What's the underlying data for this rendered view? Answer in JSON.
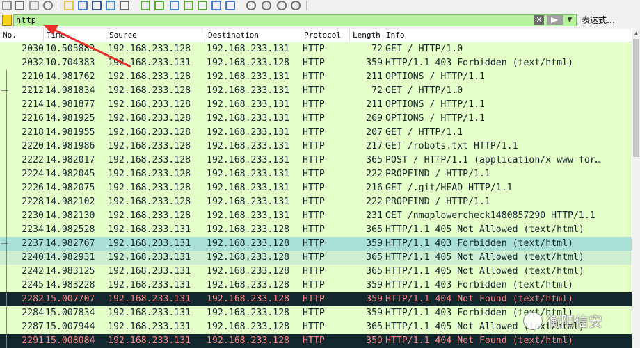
{
  "toolbar": {
    "icons": [
      "shark-fin-start-icon",
      "stop-icon",
      "restart-icon",
      "options-icon",
      "open-file-icon",
      "save-icon",
      "close-file-icon",
      "reload-icon",
      "find-icon",
      "back-icon",
      "forward-icon",
      "goto-icon",
      "first-icon",
      "last-icon",
      "autoscroll-icon",
      "colorize-icon",
      "zoom-in-icon",
      "zoom-out-icon",
      "zoom-normal-icon",
      "resize-columns-icon"
    ]
  },
  "filter": {
    "value": "http",
    "expression_label": "表达式…",
    "background": "#b8f29f"
  },
  "columns": [
    "No.",
    "Time",
    "Source",
    "Destination",
    "Protocol",
    "Length",
    "Info"
  ],
  "rows": [
    {
      "no": "2030",
      "time": "10.505883",
      "src": "192.168.233.128",
      "dst": "192.168.233.131",
      "proto": "HTTP",
      "len": "72",
      "info": "GET / HTTP/1.0",
      "style": "normal"
    },
    {
      "no": "2032",
      "time": "10.704383",
      "src": "192.168.233.131",
      "dst": "192.168.233.128",
      "proto": "HTTP",
      "len": "359",
      "info": "HTTP/1.1 403 Forbidden  (text/html)",
      "style": "normal"
    },
    {
      "no": "2210",
      "time": "14.981762",
      "src": "192.168.233.128",
      "dst": "192.168.233.131",
      "proto": "HTTP",
      "len": "211",
      "info": "OPTIONS / HTTP/1.1",
      "style": "normal"
    },
    {
      "no": "2212",
      "time": "14.981834",
      "src": "192.168.233.128",
      "dst": "192.168.233.131",
      "proto": "HTTP",
      "len": "72",
      "info": "GET / HTTP/1.0",
      "style": "normal"
    },
    {
      "no": "2214",
      "time": "14.981877",
      "src": "192.168.233.128",
      "dst": "192.168.233.131",
      "proto": "HTTP",
      "len": "211",
      "info": "OPTIONS / HTTP/1.1",
      "style": "normal"
    },
    {
      "no": "2216",
      "time": "14.981925",
      "src": "192.168.233.128",
      "dst": "192.168.233.131",
      "proto": "HTTP",
      "len": "269",
      "info": "OPTIONS / HTTP/1.1",
      "style": "normal"
    },
    {
      "no": "2218",
      "time": "14.981955",
      "src": "192.168.233.128",
      "dst": "192.168.233.131",
      "proto": "HTTP",
      "len": "207",
      "info": "GET / HTTP/1.1",
      "style": "normal"
    },
    {
      "no": "2220",
      "time": "14.981986",
      "src": "192.168.233.128",
      "dst": "192.168.233.131",
      "proto": "HTTP",
      "len": "217",
      "info": "GET /robots.txt HTTP/1.1",
      "style": "normal"
    },
    {
      "no": "2222",
      "time": "14.982017",
      "src": "192.168.233.128",
      "dst": "192.168.233.131",
      "proto": "HTTP",
      "len": "365",
      "info": "POST / HTTP/1.1  (application/x-www-for…",
      "style": "normal"
    },
    {
      "no": "2224",
      "time": "14.982045",
      "src": "192.168.233.128",
      "dst": "192.168.233.131",
      "proto": "HTTP",
      "len": "222",
      "info": "PROPFIND / HTTP/1.1",
      "style": "normal"
    },
    {
      "no": "2226",
      "time": "14.982075",
      "src": "192.168.233.128",
      "dst": "192.168.233.131",
      "proto": "HTTP",
      "len": "216",
      "info": "GET /.git/HEAD HTTP/1.1",
      "style": "normal"
    },
    {
      "no": "2228",
      "time": "14.982102",
      "src": "192.168.233.128",
      "dst": "192.168.233.131",
      "proto": "HTTP",
      "len": "222",
      "info": "PROPFIND / HTTP/1.1",
      "style": "normal"
    },
    {
      "no": "2230",
      "time": "14.982130",
      "src": "192.168.233.128",
      "dst": "192.168.233.131",
      "proto": "HTTP",
      "len": "231",
      "info": "GET /nmaplowercheck1480857290 HTTP/1.1",
      "style": "normal"
    },
    {
      "no": "2234",
      "time": "14.982528",
      "src": "192.168.233.131",
      "dst": "192.168.233.128",
      "proto": "HTTP",
      "len": "365",
      "info": "HTTP/1.1 405 Not Allowed  (text/html)",
      "style": "normal"
    },
    {
      "no": "2237",
      "time": "14.982767",
      "src": "192.168.233.131",
      "dst": "192.168.233.128",
      "proto": "HTTP",
      "len": "359",
      "info": "HTTP/1.1 403 Forbidden  (text/html)",
      "style": "related"
    },
    {
      "no": "2240",
      "time": "14.982931",
      "src": "192.168.233.131",
      "dst": "192.168.233.128",
      "proto": "HTTP",
      "len": "365",
      "info": "HTTP/1.1 405 Not Allowed  (text/html)",
      "style": "related2"
    },
    {
      "no": "2242",
      "time": "14.983125",
      "src": "192.168.233.131",
      "dst": "192.168.233.128",
      "proto": "HTTP",
      "len": "365",
      "info": "HTTP/1.1 405 Not Allowed  (text/html)",
      "style": "normal"
    },
    {
      "no": "2245",
      "time": "14.983228",
      "src": "192.168.233.131",
      "dst": "192.168.233.128",
      "proto": "HTTP",
      "len": "359",
      "info": "HTTP/1.1 403 Forbidden  (text/html)",
      "style": "normal"
    },
    {
      "no": "2282",
      "time": "15.007707",
      "src": "192.168.233.131",
      "dst": "192.168.233.128",
      "proto": "HTTP",
      "len": "359",
      "info": "HTTP/1.1 404 Not Found  (text/html)",
      "style": "error"
    },
    {
      "no": "2284",
      "time": "15.007834",
      "src": "192.168.233.131",
      "dst": "192.168.233.128",
      "proto": "HTTP",
      "len": "359",
      "info": "HTTP/1.1 403 Forbidden  (text/html)",
      "style": "normal"
    },
    {
      "no": "2287",
      "time": "15.007944",
      "src": "192.168.233.131",
      "dst": "192.168.233.128",
      "proto": "HTTP",
      "len": "365",
      "info": "HTTP/1.1 405 Not Allowed  (text/html)",
      "style": "normal"
    },
    {
      "no": "2291",
      "time": "15.008084",
      "src": "192.168.233.131",
      "dst": "192.168.233.128",
      "proto": "HTTP",
      "len": "359",
      "info": "HTTP/1.1 404 Not Found  (text/html)",
      "style": "error"
    }
  ],
  "row_colors": {
    "normal": {
      "bg": "#e4ffc7",
      "fg": "#12272e"
    },
    "related": {
      "bg": "#aadfd6",
      "fg": "#12272e"
    },
    "related2": {
      "bg": "#cdeed0",
      "fg": "#12272e"
    },
    "error": {
      "bg": "#12272e",
      "fg": "#f78787"
    }
  },
  "watermark": {
    "text": "衡阳信安"
  },
  "annotation": {
    "color": "#e8312c"
  }
}
